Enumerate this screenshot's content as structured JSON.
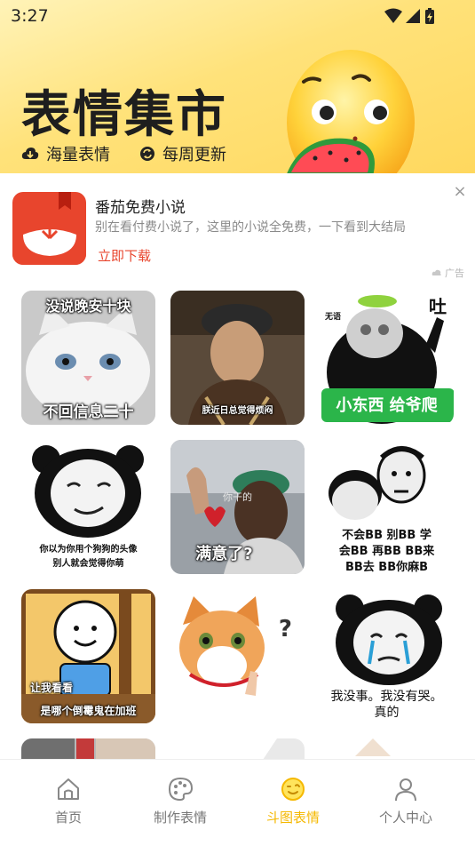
{
  "status_bar": {
    "time": "3:27"
  },
  "banner": {
    "title": "表情集市",
    "features": [
      "海量表情",
      "每周更新"
    ]
  },
  "ad": {
    "title": "番茄免费小说",
    "description": "别在看付费小说了，这里的小说全免费，一下看到大结局",
    "cta": "立即下载",
    "tag": "广告",
    "close": "×"
  },
  "memes": [
    {
      "top": "没说晚安十块",
      "bottom": "不回信息二十"
    },
    {
      "bottom": "朕近日总觉得烦闷"
    },
    {
      "top_right": "吐",
      "top_left": "无语",
      "bottom": "小东西 给爷爬"
    },
    {
      "bottom_lines": [
        "你以为你用个狗狗的头像",
        "别人就会觉得你萌"
      ]
    },
    {
      "top": "你干的",
      "bottom": "满意了?"
    },
    {
      "bottom_lines": [
        "不会BB 别BB 学",
        "会BB 再BB BB来",
        "BB去 BB你麻B"
      ]
    },
    {
      "top": "让我看看",
      "bottom": "是哪个倒霉鬼在加班"
    },
    {
      "mark": "?"
    },
    {
      "bottom_lines": [
        "我没事。我没有哭。",
        "真的"
      ]
    }
  ],
  "nav": {
    "items": [
      {
        "label": "首页",
        "icon": "home-icon"
      },
      {
        "label": "制作表情",
        "icon": "palette-icon"
      },
      {
        "label": "斗图表情",
        "icon": "emoji-icon"
      },
      {
        "label": "个人中心",
        "icon": "user-icon"
      }
    ],
    "active_index": 2
  },
  "colors": {
    "accent": "#f5b800",
    "ad_red": "#e8452d",
    "banner_yellow": "#ffe27a"
  }
}
